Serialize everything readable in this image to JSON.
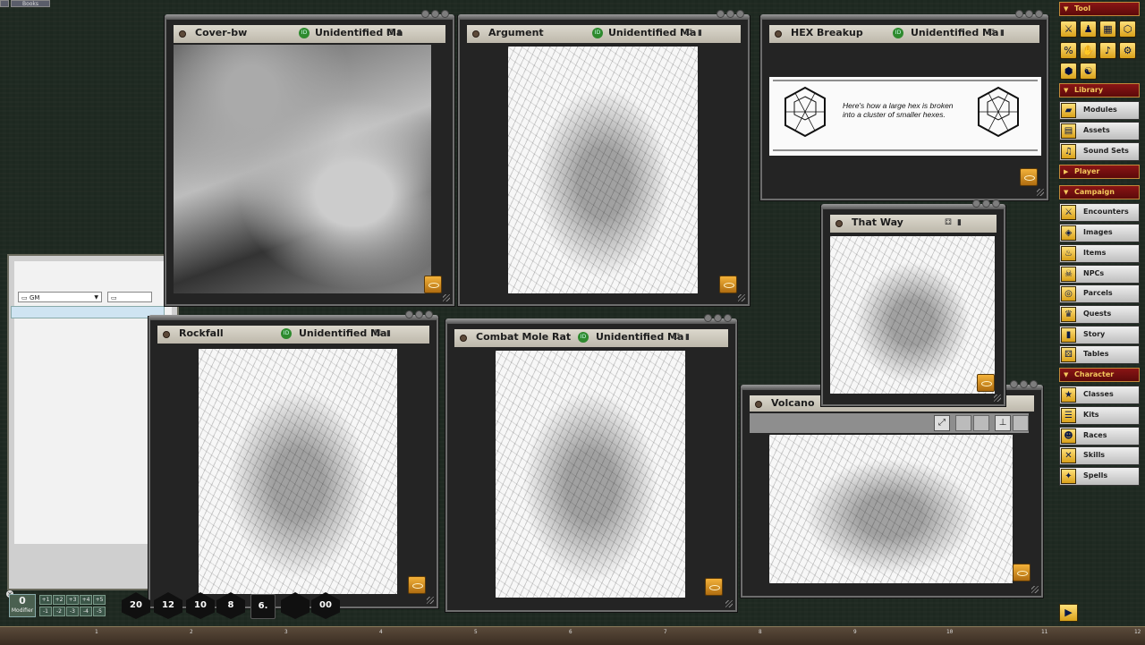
{
  "top_tabs": [
    "",
    "Books"
  ],
  "chat": {
    "identity": "GM",
    "target": ""
  },
  "windows": [
    {
      "title": "Cover-bw",
      "subtitle": "Unidentified Ma"
    },
    {
      "title": "Argument",
      "subtitle": "Unidentified Ma"
    },
    {
      "title": "HEX Breakup",
      "subtitle": "Unidentified Ma",
      "caption": "Here's how a large hex is broken into a cluster of smaller hexes."
    },
    {
      "title": "That Way",
      "subtitle": ""
    },
    {
      "title": "Rockfall",
      "subtitle": "Unidentified Ma"
    },
    {
      "title": "Combat Mole Rat",
      "subtitle": "Unidentified Ma"
    },
    {
      "title": "Volcano",
      "subtitle": ""
    }
  ],
  "sidebar": {
    "sections": [
      {
        "label": "Tool"
      },
      {
        "label": "Library"
      },
      {
        "label": "Player"
      },
      {
        "label": "Campaign"
      },
      {
        "label": "Character"
      }
    ],
    "library": [
      "Modules",
      "Assets",
      "Sound Sets"
    ],
    "campaign": [
      "Encounters",
      "Images",
      "Items",
      "NPCs",
      "Parcels",
      "Quests",
      "Story",
      "Tables"
    ],
    "character": [
      "Classes",
      "Kits",
      "Races",
      "Skills",
      "Spells"
    ]
  },
  "modifier": {
    "value": "0",
    "label": "Modifier"
  },
  "mod_buttons": [
    "+1",
    "+2",
    "+3",
    "+4",
    "+5",
    "-1",
    "-2",
    "-3",
    "-4",
    "-5"
  ],
  "dice": [
    "20",
    "12",
    "10",
    "8",
    "6.",
    "",
    "00"
  ],
  "ruler": [
    "1",
    "2",
    "3",
    "4",
    "5",
    "6",
    "7",
    "8",
    "9",
    "10",
    "11",
    "12"
  ]
}
